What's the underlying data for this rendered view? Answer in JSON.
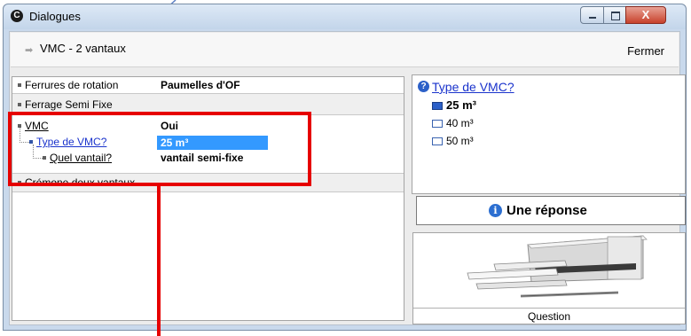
{
  "window": {
    "title": "Dialogues",
    "close_symbol": "X"
  },
  "header": {
    "breadcrumb": "VMC - 2 vantaux",
    "close_label": "Fermer"
  },
  "rows": {
    "ferrures_label": "Ferrures de rotation",
    "ferrures_value": "Paumelles d'OF",
    "ferrage_label": "Ferrage Semi Fixe",
    "vmc_label": "VMC",
    "vmc_value": "Oui",
    "type_label": "Type de VMC?",
    "type_value": "25 m³",
    "vantail_label": "Quel vantail?",
    "vantail_value": "vantail semi-fixe",
    "cremone_label": "Crémone deux vantaux"
  },
  "question": {
    "title": "Type de VMC?",
    "options": [
      {
        "label": "25 m³",
        "selected": true
      },
      {
        "label": "40 m³",
        "selected": false
      },
      {
        "label": "50 m³",
        "selected": false
      }
    ]
  },
  "answer_button": {
    "label": "Une réponse"
  },
  "image_panel": {
    "caption": "Question"
  },
  "colors": {
    "highlight": "#e60000",
    "selection": "#3399ff",
    "link": "#1a33cc"
  }
}
